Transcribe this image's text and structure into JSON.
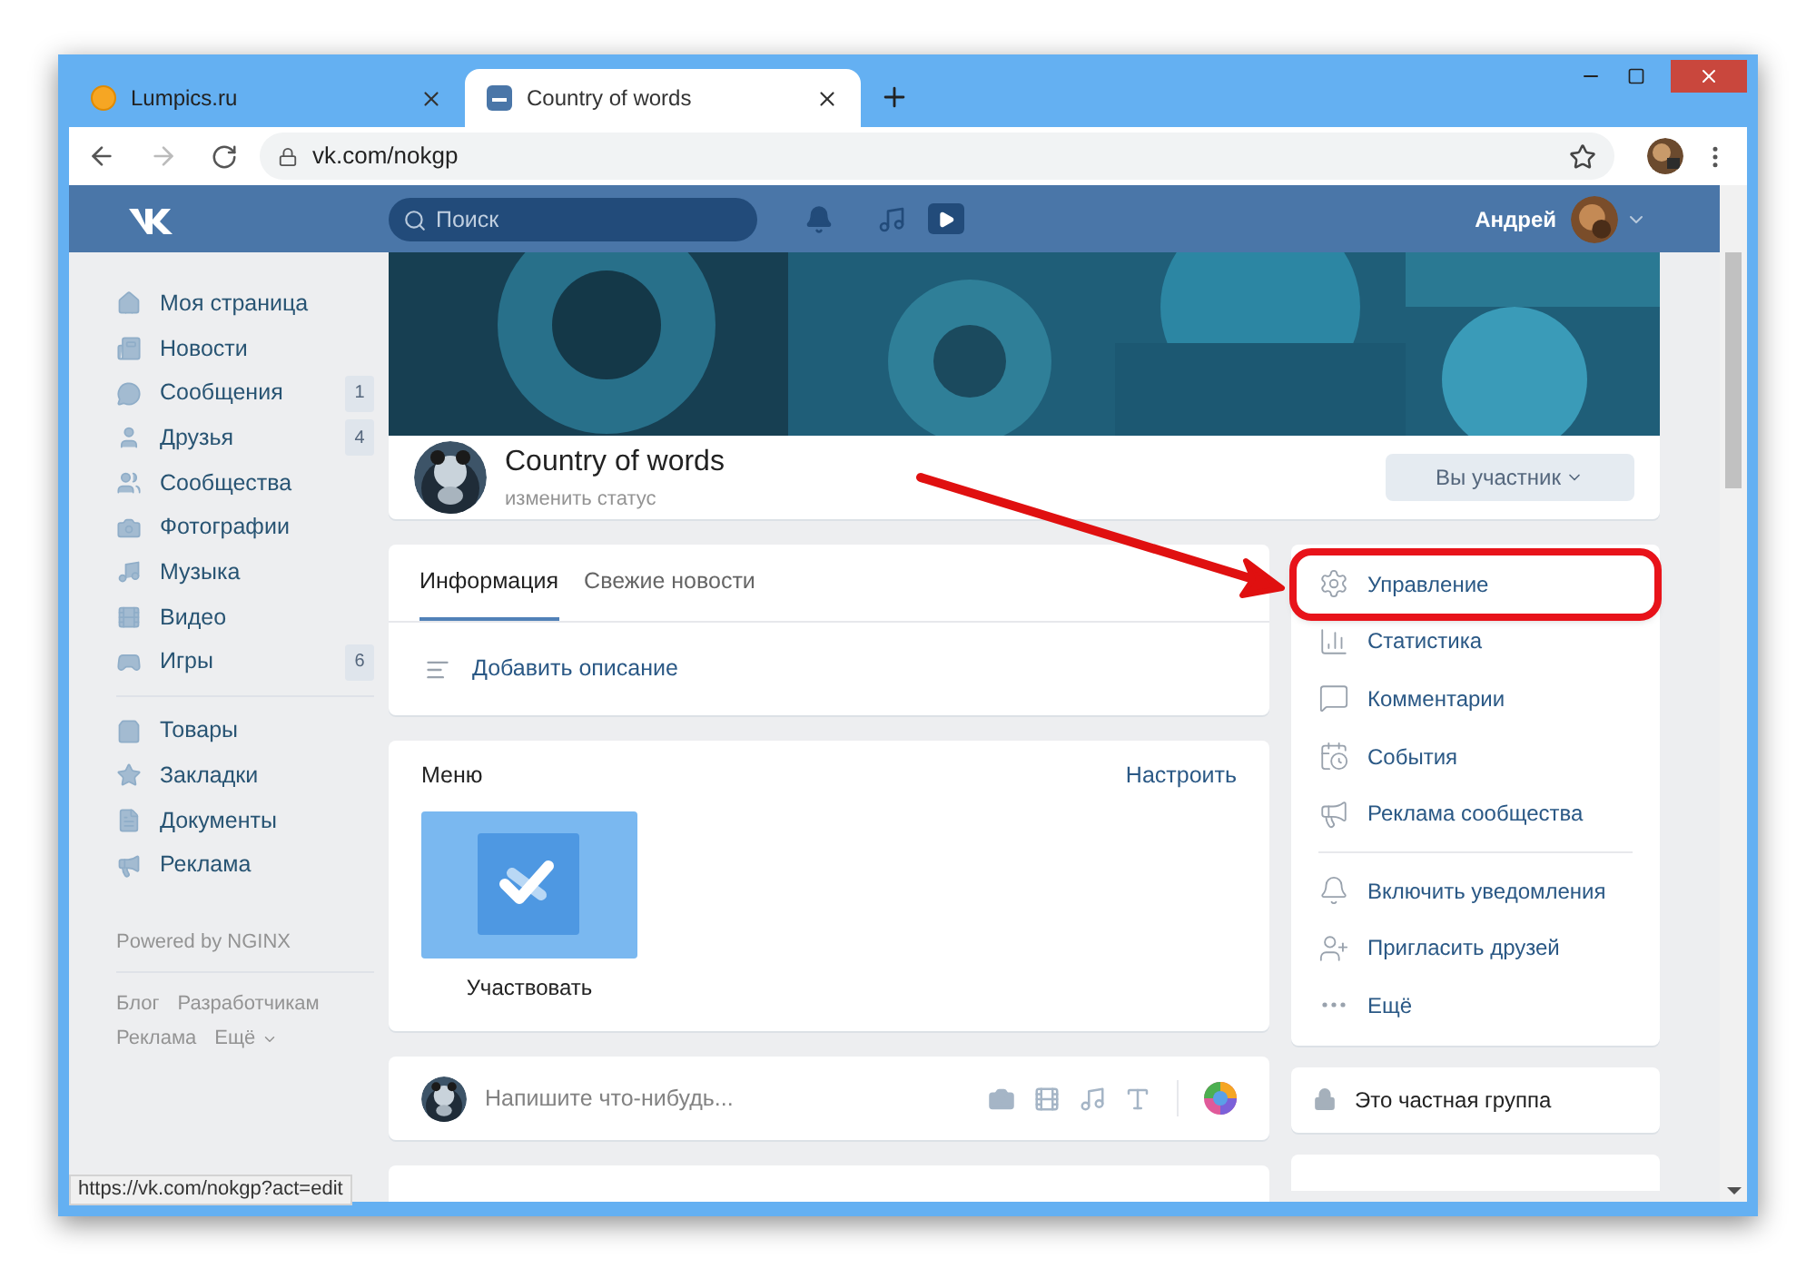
{
  "browser": {
    "tabs": [
      {
        "title": "Lumpics.ru",
        "selected": false
      },
      {
        "title": "Country of words",
        "selected": true
      }
    ],
    "url": "vk.com/nokgp",
    "status_url": "https://vk.com/nokgp?act=edit"
  },
  "header": {
    "search_placeholder": "Поиск",
    "user_name": "Андрей"
  },
  "sidebar": {
    "groups": [
      [
        {
          "label": "Моя страница"
        },
        {
          "label": "Новости"
        },
        {
          "label": "Сообщения",
          "badge": "1"
        },
        {
          "label": "Друзья",
          "badge": "4"
        },
        {
          "label": "Сообщества"
        },
        {
          "label": "Фотографии"
        },
        {
          "label": "Музыка"
        },
        {
          "label": "Видео"
        },
        {
          "label": "Игры",
          "badge": "6"
        }
      ],
      [
        {
          "label": "Товары"
        },
        {
          "label": "Закладки"
        },
        {
          "label": "Документы"
        },
        {
          "label": "Реклама"
        }
      ]
    ],
    "powered": "Powered by NGINX",
    "footer_links": [
      "Блог",
      "Разработчикам",
      "Реклама",
      "Ещё"
    ]
  },
  "group": {
    "name": "Country of words",
    "status": "изменить статус",
    "member_button": "Вы участник"
  },
  "info_tabs": [
    {
      "label": "Информация",
      "selected": true
    },
    {
      "label": "Свежие новости",
      "selected": false
    }
  ],
  "add_description": "Добавить описание",
  "menu": {
    "title": "Меню",
    "configure": "Настроить",
    "items": [
      {
        "label": "Участвовать"
      }
    ]
  },
  "composer": {
    "placeholder": "Напишите что-нибудь..."
  },
  "actions": [
    [
      {
        "label": "Управление",
        "highlighted": true
      },
      {
        "label": "Статистика",
        "highlighted": false
      },
      {
        "label": "Комментарии",
        "highlighted": false
      },
      {
        "label": "События",
        "highlighted": false
      },
      {
        "label": "Реклама сообщества",
        "highlighted": false
      }
    ],
    [
      {
        "label": "Включить уведомления",
        "highlighted": false
      },
      {
        "label": "Пригласить друзей",
        "highlighted": false
      },
      {
        "label": "Ещё",
        "highlighted": false
      }
    ]
  ],
  "private_notice": "Это частная группа"
}
